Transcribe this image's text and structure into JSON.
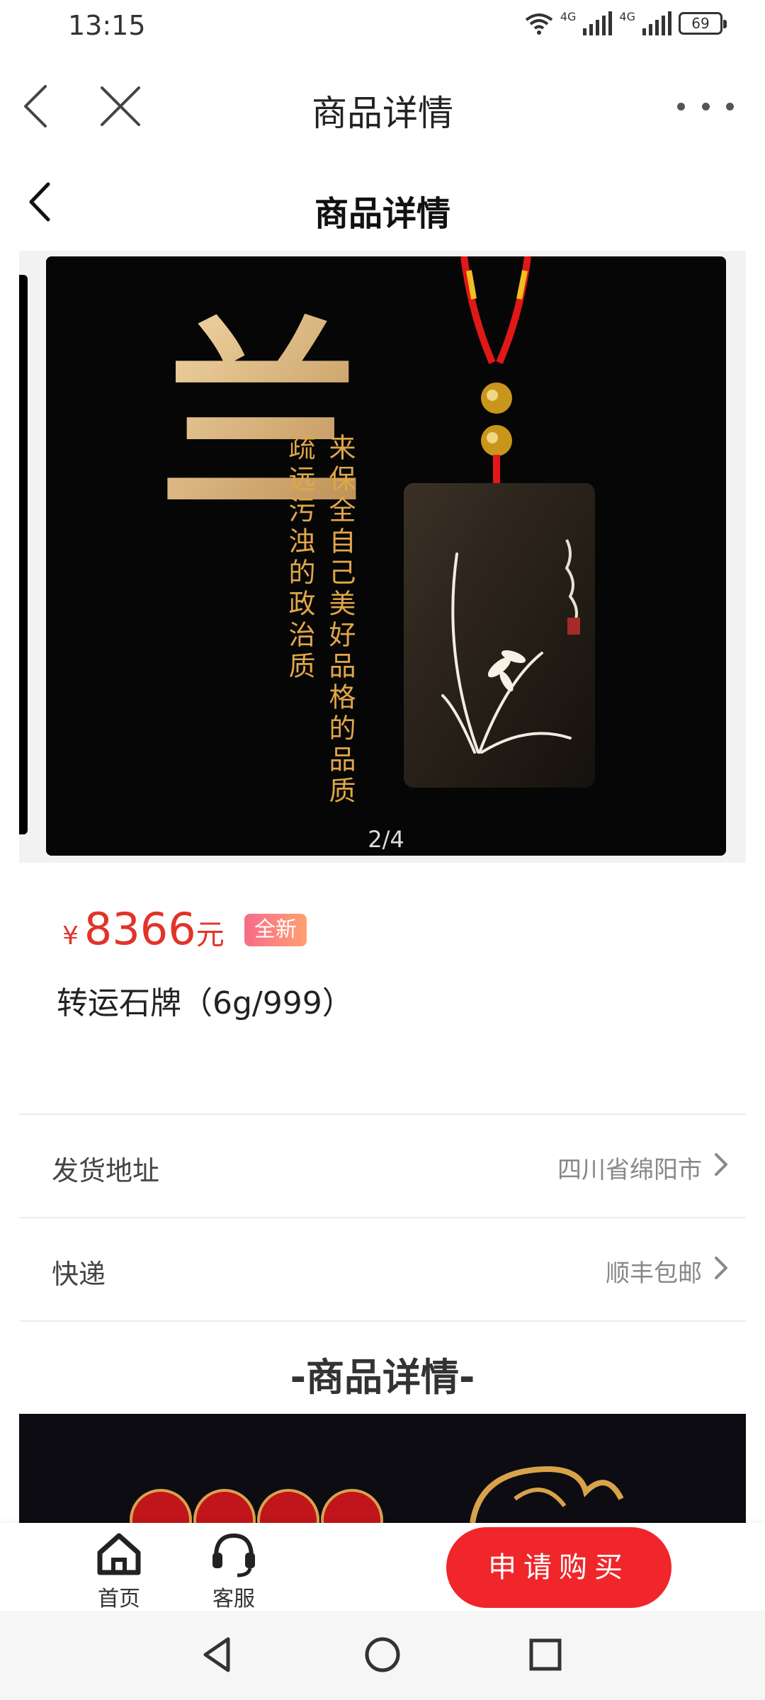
{
  "status_bar": {
    "time": "13:15",
    "network_1": "4G",
    "network_2": "4G",
    "battery": "69"
  },
  "browser_nav": {
    "title": "商品详情",
    "icons": [
      "back-arrow",
      "close-x",
      "more-dots"
    ]
  },
  "page_header": {
    "title": "商品详情"
  },
  "gallery": {
    "counter": "2/4",
    "image": {
      "big_char": "兰",
      "poem_col_1": "来保全自己美好品格的品质",
      "poem_col_2": "疏远污浊的政治质"
    }
  },
  "product": {
    "currency": "¥",
    "price": "8366",
    "unit": "元",
    "badge": "全新",
    "name": "转运石牌（6g/999）"
  },
  "info_rows": {
    "shipping_address": {
      "label": "发货地址",
      "value": "四川省绵阳市"
    },
    "express": {
      "label": "快递",
      "value": "顺丰包邮"
    }
  },
  "detail": {
    "heading": "-商品详情-"
  },
  "bottom_bar": {
    "home_label": "首页",
    "service_label": "客服",
    "buy_label": "申请购买"
  },
  "colors": {
    "price_red": "#e0342a",
    "buy_button": "#f0262a",
    "badge_gradient_start": "#f76b8a",
    "badge_gradient_end": "#ffa071",
    "gold": "#d9a24a"
  }
}
